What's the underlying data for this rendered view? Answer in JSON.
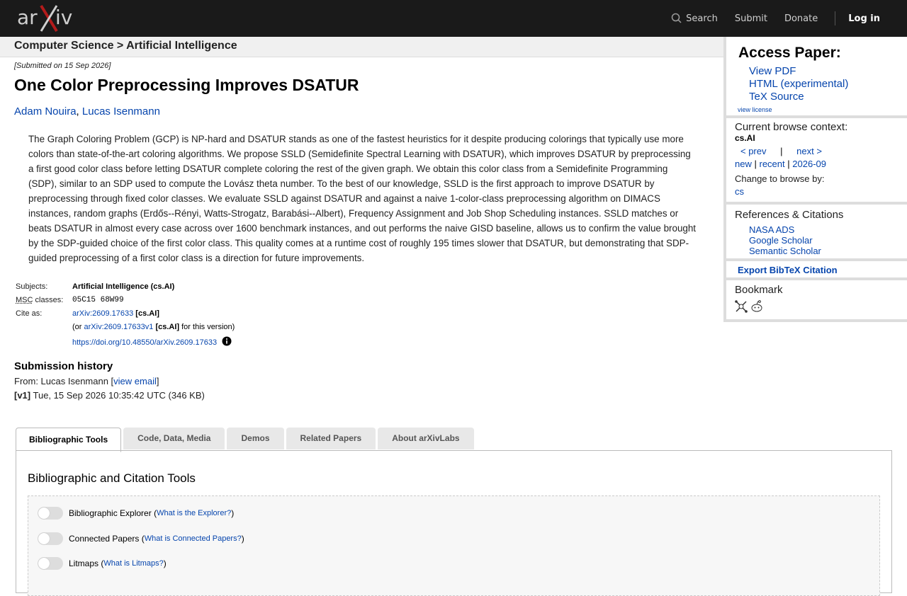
{
  "nav": {
    "search": "Search",
    "submit": "Submit",
    "donate": "Donate",
    "login": "Log in"
  },
  "breadcrumb": "Computer Science > Artificial Intelligence",
  "paper": {
    "submitted": "[Submitted on 15 Sep 2026]",
    "title": "One Color Preprocessing Improves DSATUR",
    "authors": [
      "Adam Nouira",
      "Lucas Isenmann"
    ],
    "abstract": "The Graph Coloring Problem (GCP) is NP-hard and DSATUR stands as one of the fastest heuristics for it despite producing colorings that typically use more colors than state-of-the-art coloring algorithms. We propose SSLD (Semidefinite Spectral Learning with DSATUR), which improves DSATUR by preprocessing a first good color class before letting DSATUR complete coloring the rest of the given graph. We obtain this color class from a Semidefinite Programming (SDP), similar to an SDP used to compute the Lovász theta number. To the best of our knowledge, SSLD is the first approach to improve DSATUR by preprocessing through fixed color classes. We evaluate SSLD against DSATUR and against a naive 1-color-class preprocessing algorithm on DIMACS instances, random graphs (Erdős--Rényi, Watts-Strogatz, Barabási--Albert), Frequency Assignment and Job Shop Scheduling instances. SSLD matches or beats DSATUR in almost every case across over 1600 benchmark instances, and out performs the naive GISD baseline, allows us to confirm the value brought by the SDP-guided choice of the first color class. This quality comes at a runtime cost of roughly 195 times slower that DSATUR, but demonstrating that SDP-guided preprocessing of a first color class is a direction for future improvements.",
    "subjects_label": "Subjects:",
    "subjects": "Artificial Intelligence (cs.AI)",
    "msc_abbr": "MSC",
    "msc_label": "classes:",
    "msc": "05C15 68W99",
    "cite_label": "Cite as:",
    "cite_id": "arXiv:2609.17633",
    "cite_cat": "[cs.AI]",
    "cite_or": "(or",
    "cite_v1": "arXiv:2609.17633v1",
    "cite_cat2": "[cs.AI]",
    "cite_suffix": "for this version)",
    "doi": "https://doi.org/10.48550/arXiv.2609.17633"
  },
  "history": {
    "heading": "Submission history",
    "from_label": "From: Lucas Isenmann [",
    "view_email": "view email",
    "from_close": "]",
    "version": "[v1]",
    "version_text": "Tue, 15 Sep 2026 10:35:42 UTC (346 KB)"
  },
  "tabs": [
    "Bibliographic Tools",
    "Code, Data, Media",
    "Demos",
    "Related Papers",
    "About arXivLabs"
  ],
  "tools": {
    "heading": "Bibliographic and Citation Tools",
    "items": [
      {
        "label": "Bibliographic Explorer",
        "link": "What is the Explorer?"
      },
      {
        "label": "Connected Papers",
        "link": "What is Connected Papers?"
      },
      {
        "label": "Litmaps",
        "link": "What is Litmaps?"
      }
    ]
  },
  "sidebar": {
    "access_heading": "Access Paper:",
    "access_links": [
      "View PDF",
      "HTML (experimental)",
      "TeX Source"
    ],
    "license": "view license",
    "context_heading": "Current browse context:",
    "context_cat": "cs.AI",
    "prev": "< prev",
    "pipe": "|",
    "next": "next >",
    "new": "new",
    "recent": "recent",
    "month": "2026-09",
    "change_by": "Change to browse by:",
    "cs": "cs",
    "refs_heading": "References & Citations",
    "refs": [
      "NASA ADS",
      "Google Scholar",
      "Semantic Scholar"
    ],
    "export": "Export BibTeX Citation",
    "bookmark": "Bookmark"
  }
}
